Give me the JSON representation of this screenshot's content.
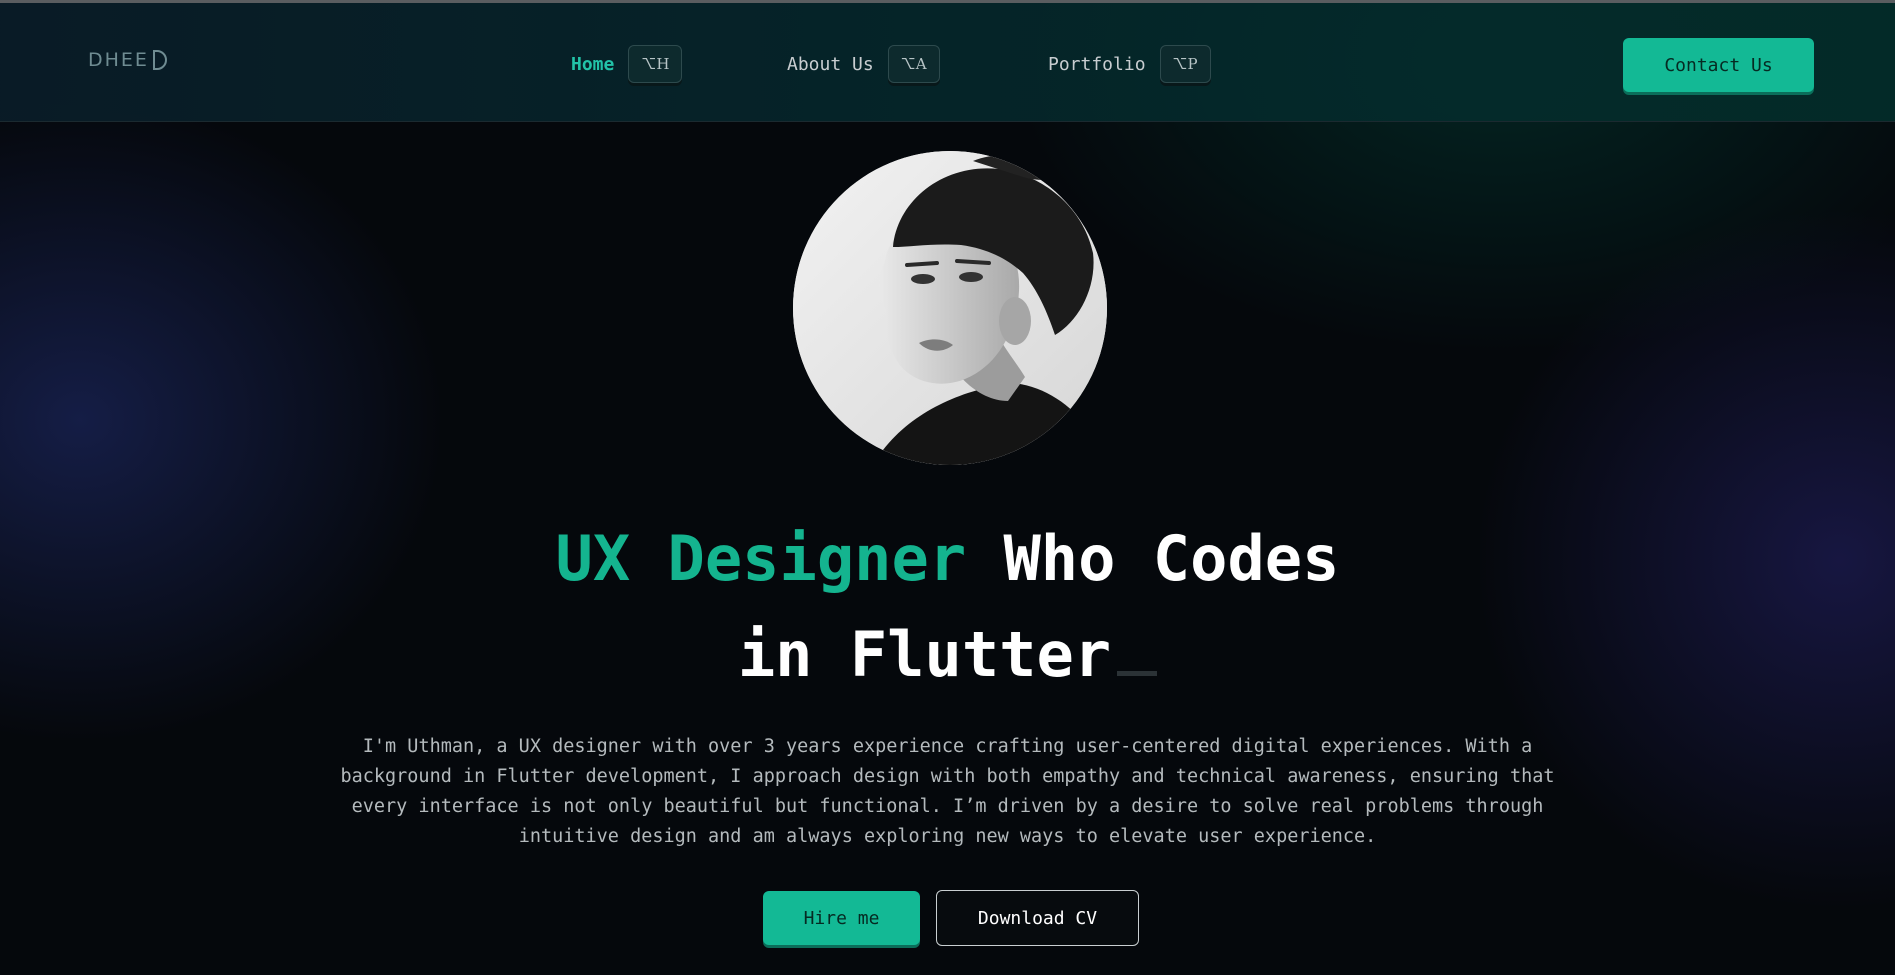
{
  "nav": {
    "logo_text": "DHEE",
    "items": [
      {
        "label": "Home",
        "shortcut": "⌥H",
        "active": true
      },
      {
        "label": "About Us",
        "shortcut": "⌥A",
        "active": false
      },
      {
        "label": "Portfolio",
        "shortcut": "⌥P",
        "active": false
      }
    ],
    "contact_label": "Contact Us"
  },
  "hero": {
    "avatar_icon": "portrait-photo",
    "headline_accent": "UX Designer",
    "headline_rest": "Who Codes",
    "headline_line2": "in Flutter",
    "bio": "I'm Uthman, a UX designer with over 3 years experience crafting user-centered digital experiences. With a background in Flutter development, I approach design with both empathy and technical awareness, ensuring that every interface is not only beautiful but functional. I’m driven by a desire to solve real problems through intuitive design and am always exploring new ways to elevate user experience.",
    "hire_label": "Hire me",
    "cv_label": "Download CV"
  },
  "colors": {
    "accent": "#14b48f",
    "background": "#05080c"
  }
}
